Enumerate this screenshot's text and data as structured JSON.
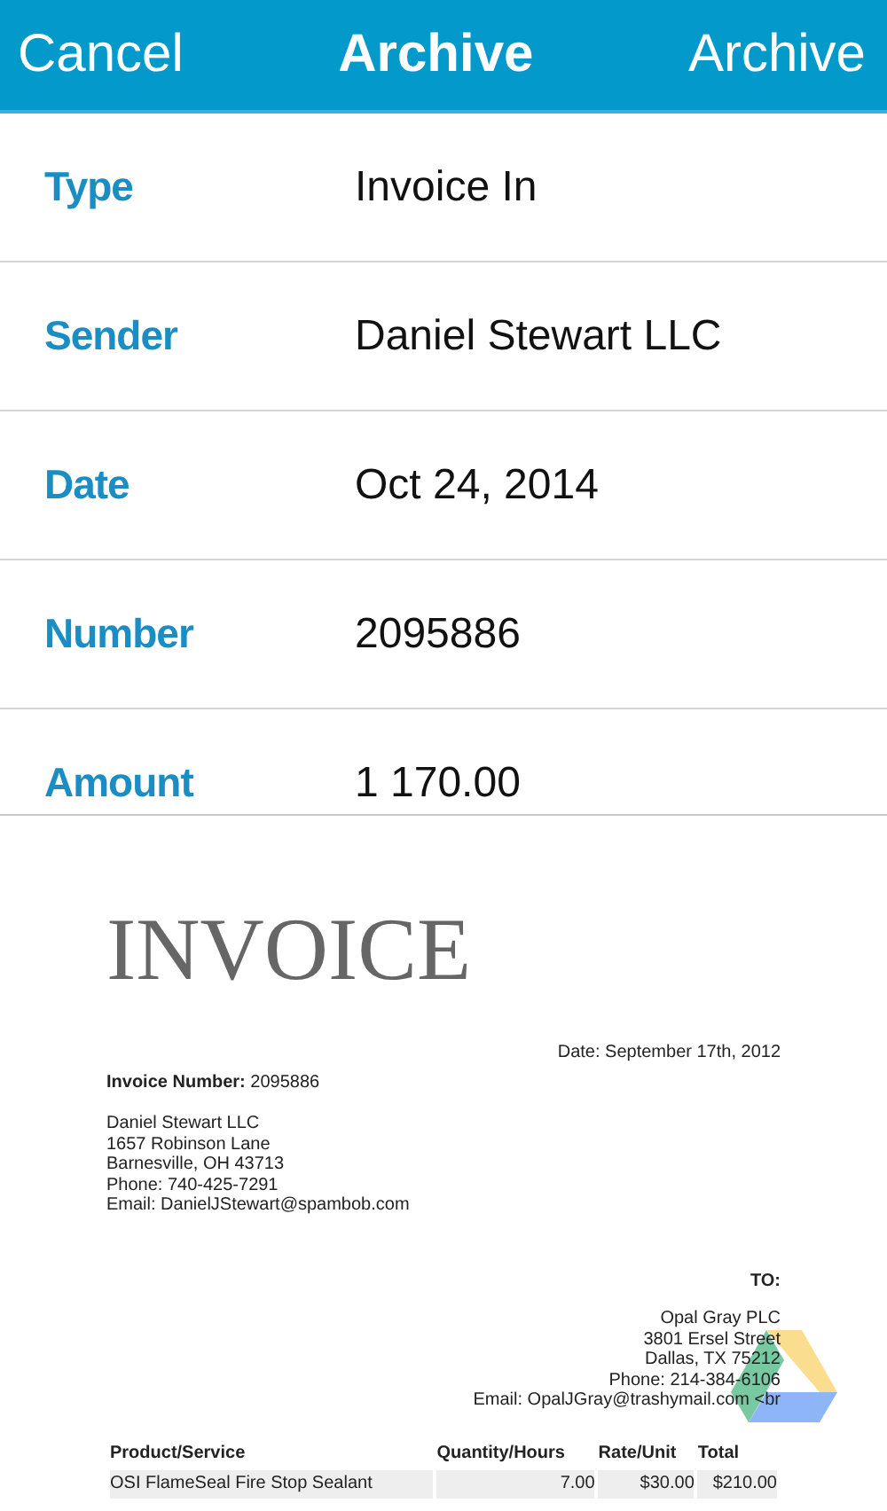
{
  "nav": {
    "left": "Cancel",
    "title": "Archive",
    "right": "Archive"
  },
  "fields": [
    {
      "label": "Type",
      "value": "Invoice In"
    },
    {
      "label": "Sender",
      "value": "Daniel Stewart LLC"
    },
    {
      "label": "Date",
      "value": "Oct 24, 2014"
    },
    {
      "label": "Number",
      "value": "2095886"
    },
    {
      "label": "Amount",
      "value": "1 170.00"
    }
  ],
  "document": {
    "heading": "INVOICE",
    "date": "Date: September 17th, 2012",
    "invoice_number": "**Invoice Number:** 2095886",
    "sender_lines": [
      "Daniel Stewart LLC",
      "1657 Robinson Lane",
      "Barnesville, OH 43713",
      "Phone: 740-425-7291",
      "Email: DanielJStewart@spambob.com"
    ],
    "to_label": "TO:",
    "recipient_lines": [
      "Opal Gray PLC",
      "3801 Ersel Street",
      "Dallas, TX 75212",
      "Phone: 214-384-6106",
      "Email: OpalJGray@trashymail.com <br"
    ],
    "table": {
      "columns": [
        "Product/Service",
        "Quantity/Hours",
        "Rate/Unit",
        "Total"
      ],
      "rows": [
        [
          "OSI FlameSeal Fire Stop Sealant",
          "7.00",
          "$30.00",
          "$210.00"
        ]
      ]
    }
  }
}
